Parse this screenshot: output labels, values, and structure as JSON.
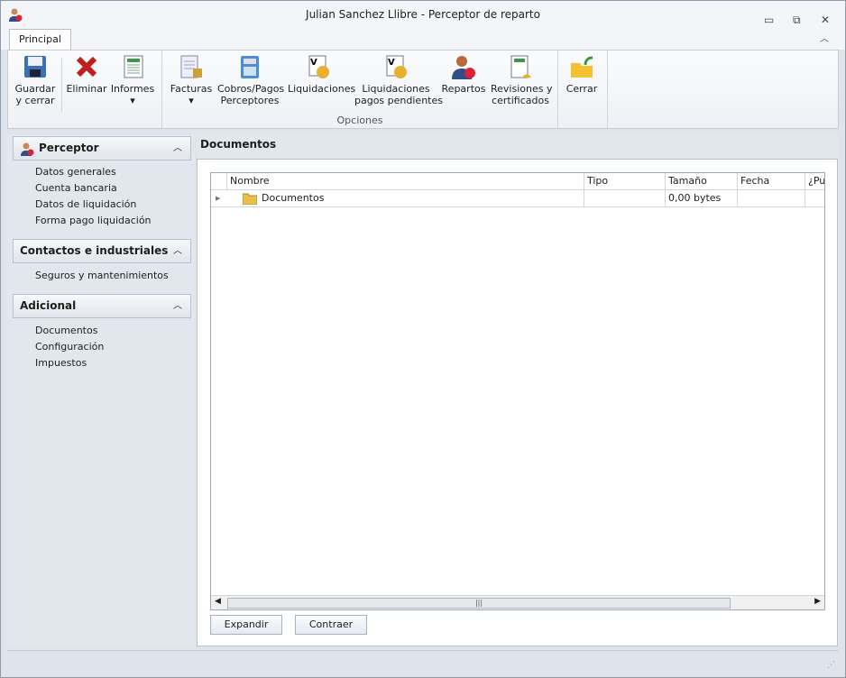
{
  "window": {
    "title": "Julian Sanchez Llibre - Perceptor de reparto",
    "minimize": "▭",
    "restore": "⧉",
    "close": "✕"
  },
  "ribbon": {
    "tab": "Principal",
    "collapse_icon": "chevron-up",
    "buttons": {
      "guardar": "Guardar\ny cerrar",
      "eliminar": "Eliminar",
      "informes": "Informes",
      "facturas": "Facturas",
      "cobros": "Cobros/Pagos\nPerceptores",
      "liquidaciones": "Liquidaciones",
      "liq_pend": "Liquidaciones\npagos pendientes",
      "repartos": "Repartos",
      "revisiones": "Revisiones y\ncertificados",
      "cerrar": "Cerrar"
    },
    "group_label": "Opciones"
  },
  "sidebar": {
    "sections": [
      {
        "title": "Perceptor",
        "items": [
          "Datos generales",
          "Cuenta bancaria",
          "Datos de liquidación",
          "Forma pago liquidación"
        ]
      },
      {
        "title": "Contactos e industriales",
        "items": [
          "Seguros y mantenimientos"
        ]
      },
      {
        "title": "Adicional",
        "items": [
          "Documentos",
          "Configuración",
          "Impuestos"
        ]
      }
    ]
  },
  "main": {
    "title": "Documentos",
    "columns": [
      "Nombre",
      "Tipo",
      "Tamaño",
      "Fecha",
      "¿Pul"
    ],
    "rows": [
      {
        "nombre": "Documentos",
        "tipo": "",
        "tamano": "0,00 bytes",
        "fecha": ""
      }
    ],
    "expand": "Expandir",
    "collapse": "Contraer"
  }
}
